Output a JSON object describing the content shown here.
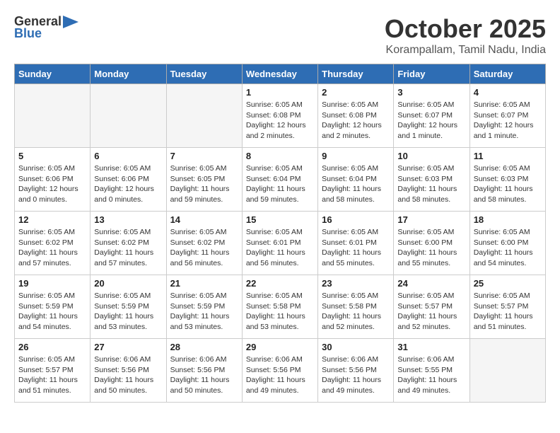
{
  "header": {
    "logo_general": "General",
    "logo_blue": "Blue",
    "title": "October 2025",
    "subtitle": "Korampallam, Tamil Nadu, India"
  },
  "days_of_week": [
    "Sunday",
    "Monday",
    "Tuesday",
    "Wednesday",
    "Thursday",
    "Friday",
    "Saturday"
  ],
  "weeks": [
    [
      {
        "day": "",
        "details": ""
      },
      {
        "day": "",
        "details": ""
      },
      {
        "day": "",
        "details": ""
      },
      {
        "day": "1",
        "details": "Sunrise: 6:05 AM\nSunset: 6:08 PM\nDaylight: 12 hours and 2 minutes."
      },
      {
        "day": "2",
        "details": "Sunrise: 6:05 AM\nSunset: 6:08 PM\nDaylight: 12 hours and 2 minutes."
      },
      {
        "day": "3",
        "details": "Sunrise: 6:05 AM\nSunset: 6:07 PM\nDaylight: 12 hours and 1 minute."
      },
      {
        "day": "4",
        "details": "Sunrise: 6:05 AM\nSunset: 6:07 PM\nDaylight: 12 hours and 1 minute."
      }
    ],
    [
      {
        "day": "5",
        "details": "Sunrise: 6:05 AM\nSunset: 6:06 PM\nDaylight: 12 hours and 0 minutes."
      },
      {
        "day": "6",
        "details": "Sunrise: 6:05 AM\nSunset: 6:06 PM\nDaylight: 12 hours and 0 minutes."
      },
      {
        "day": "7",
        "details": "Sunrise: 6:05 AM\nSunset: 6:05 PM\nDaylight: 11 hours and 59 minutes."
      },
      {
        "day": "8",
        "details": "Sunrise: 6:05 AM\nSunset: 6:04 PM\nDaylight: 11 hours and 59 minutes."
      },
      {
        "day": "9",
        "details": "Sunrise: 6:05 AM\nSunset: 6:04 PM\nDaylight: 11 hours and 58 minutes."
      },
      {
        "day": "10",
        "details": "Sunrise: 6:05 AM\nSunset: 6:03 PM\nDaylight: 11 hours and 58 minutes."
      },
      {
        "day": "11",
        "details": "Sunrise: 6:05 AM\nSunset: 6:03 PM\nDaylight: 11 hours and 58 minutes."
      }
    ],
    [
      {
        "day": "12",
        "details": "Sunrise: 6:05 AM\nSunset: 6:02 PM\nDaylight: 11 hours and 57 minutes."
      },
      {
        "day": "13",
        "details": "Sunrise: 6:05 AM\nSunset: 6:02 PM\nDaylight: 11 hours and 57 minutes."
      },
      {
        "day": "14",
        "details": "Sunrise: 6:05 AM\nSunset: 6:02 PM\nDaylight: 11 hours and 56 minutes."
      },
      {
        "day": "15",
        "details": "Sunrise: 6:05 AM\nSunset: 6:01 PM\nDaylight: 11 hours and 56 minutes."
      },
      {
        "day": "16",
        "details": "Sunrise: 6:05 AM\nSunset: 6:01 PM\nDaylight: 11 hours and 55 minutes."
      },
      {
        "day": "17",
        "details": "Sunrise: 6:05 AM\nSunset: 6:00 PM\nDaylight: 11 hours and 55 minutes."
      },
      {
        "day": "18",
        "details": "Sunrise: 6:05 AM\nSunset: 6:00 PM\nDaylight: 11 hours and 54 minutes."
      }
    ],
    [
      {
        "day": "19",
        "details": "Sunrise: 6:05 AM\nSunset: 5:59 PM\nDaylight: 11 hours and 54 minutes."
      },
      {
        "day": "20",
        "details": "Sunrise: 6:05 AM\nSunset: 5:59 PM\nDaylight: 11 hours and 53 minutes."
      },
      {
        "day": "21",
        "details": "Sunrise: 6:05 AM\nSunset: 5:59 PM\nDaylight: 11 hours and 53 minutes."
      },
      {
        "day": "22",
        "details": "Sunrise: 6:05 AM\nSunset: 5:58 PM\nDaylight: 11 hours and 53 minutes."
      },
      {
        "day": "23",
        "details": "Sunrise: 6:05 AM\nSunset: 5:58 PM\nDaylight: 11 hours and 52 minutes."
      },
      {
        "day": "24",
        "details": "Sunrise: 6:05 AM\nSunset: 5:57 PM\nDaylight: 11 hours and 52 minutes."
      },
      {
        "day": "25",
        "details": "Sunrise: 6:05 AM\nSunset: 5:57 PM\nDaylight: 11 hours and 51 minutes."
      }
    ],
    [
      {
        "day": "26",
        "details": "Sunrise: 6:05 AM\nSunset: 5:57 PM\nDaylight: 11 hours and 51 minutes."
      },
      {
        "day": "27",
        "details": "Sunrise: 6:06 AM\nSunset: 5:56 PM\nDaylight: 11 hours and 50 minutes."
      },
      {
        "day": "28",
        "details": "Sunrise: 6:06 AM\nSunset: 5:56 PM\nDaylight: 11 hours and 50 minutes."
      },
      {
        "day": "29",
        "details": "Sunrise: 6:06 AM\nSunset: 5:56 PM\nDaylight: 11 hours and 49 minutes."
      },
      {
        "day": "30",
        "details": "Sunrise: 6:06 AM\nSunset: 5:56 PM\nDaylight: 11 hours and 49 minutes."
      },
      {
        "day": "31",
        "details": "Sunrise: 6:06 AM\nSunset: 5:55 PM\nDaylight: 11 hours and 49 minutes."
      },
      {
        "day": "",
        "details": ""
      }
    ]
  ]
}
